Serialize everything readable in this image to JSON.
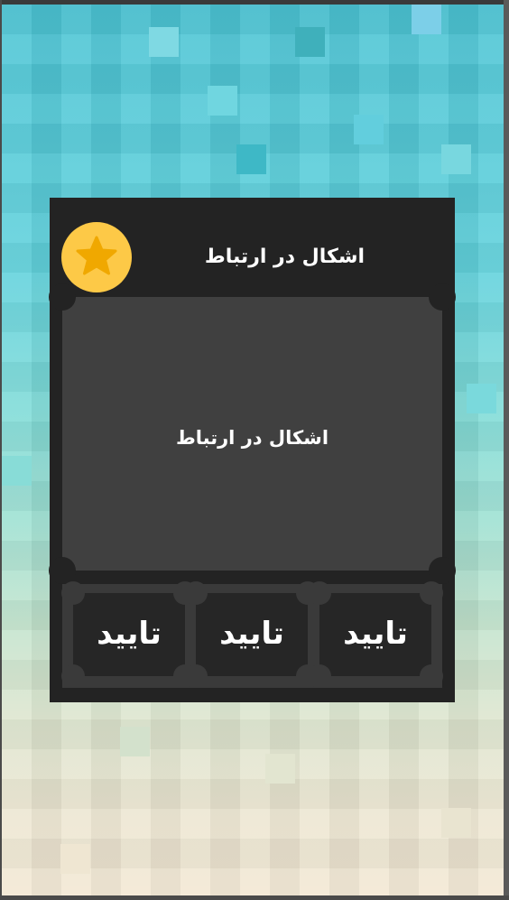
{
  "dialog": {
    "title": "اشکال در ارتباط",
    "message": "اشکال در ارتباط",
    "badge_icon": "star-icon"
  },
  "buttons": [
    {
      "label": "تایید"
    },
    {
      "label": "تایید"
    },
    {
      "label": "تایید"
    }
  ],
  "colors": {
    "dialog_bg": "#232323",
    "panel_bg": "#404040",
    "badge": "#fdc947",
    "star": "#f0a800"
  }
}
